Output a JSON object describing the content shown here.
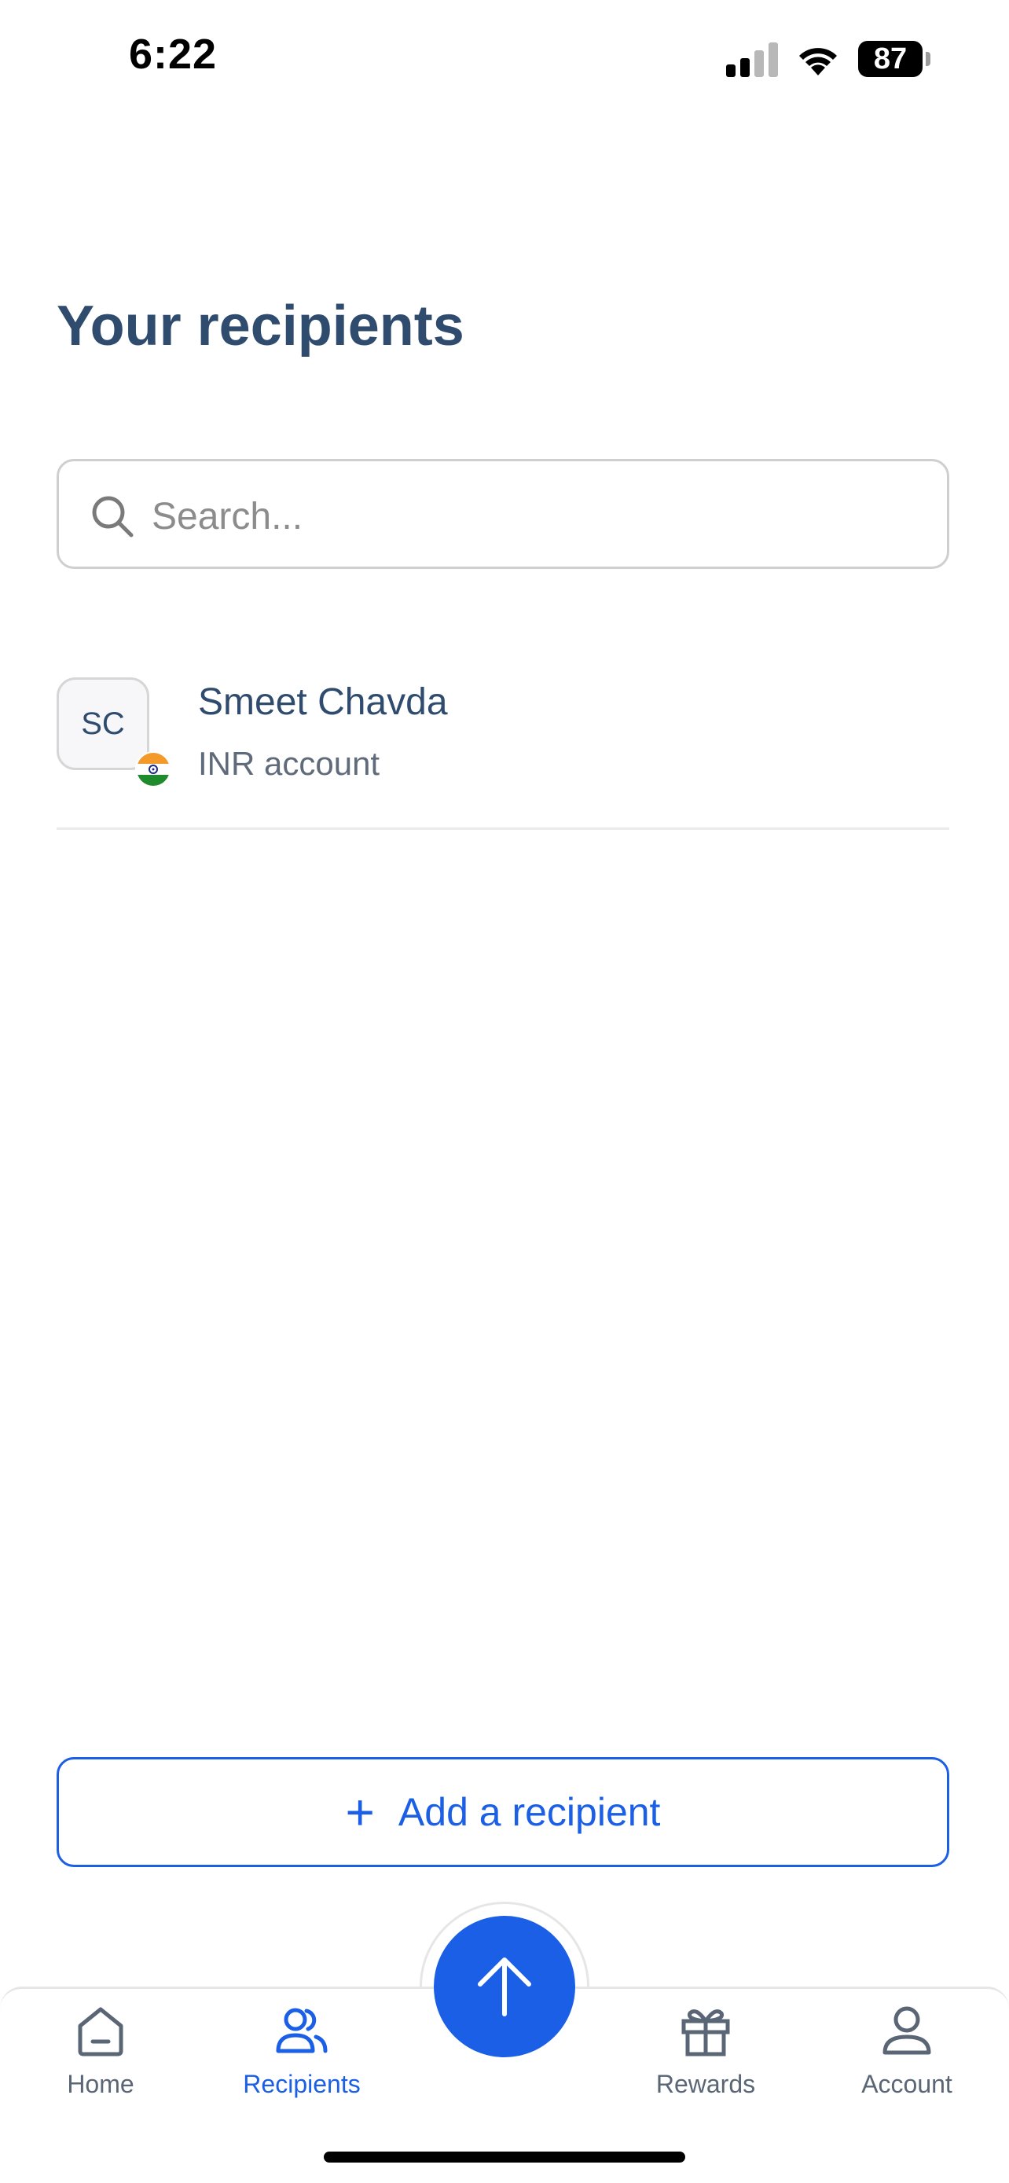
{
  "status_bar": {
    "time": "6:22",
    "battery": "87"
  },
  "page": {
    "title": "Your recipients"
  },
  "search": {
    "placeholder": "Search..."
  },
  "recipients": [
    {
      "initials": "SC",
      "name": "Smeet Chavda",
      "subtitle": "INR account",
      "flag": "india-flag"
    }
  ],
  "actions": {
    "add_label": "Add a recipient"
  },
  "nav": {
    "items": [
      {
        "label": "Home",
        "icon": "home-icon"
      },
      {
        "label": "Recipients",
        "icon": "recipients-icon"
      },
      {
        "label": "Rewards",
        "icon": "gift-icon"
      },
      {
        "label": "Account",
        "icon": "account-icon"
      }
    ],
    "fab_icon": "arrow-up-icon"
  },
  "colors": {
    "accent": "#1a5fe6",
    "title": "#2f4b6e",
    "muted": "#5f6b7a",
    "border": "#cfcfcf"
  }
}
